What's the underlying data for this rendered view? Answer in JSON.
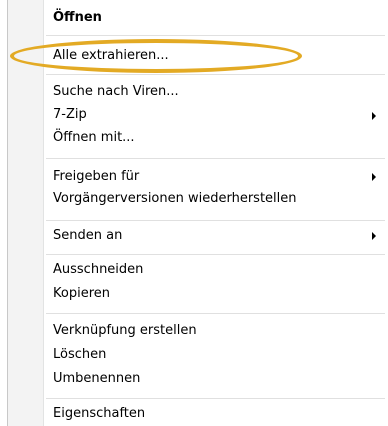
{
  "menu": {
    "items": [
      {
        "label": "Öffnen"
      },
      {
        "label": "Alle extrahieren..."
      },
      {
        "label": "Suche nach Viren..."
      },
      {
        "label": "7-Zip"
      },
      {
        "label": "Öffnen mit..."
      },
      {
        "label": "Freigeben für"
      },
      {
        "label": "Vorgängerversionen wiederherstellen"
      },
      {
        "label": "Senden an"
      },
      {
        "label": "Ausschneiden"
      },
      {
        "label": "Kopieren"
      },
      {
        "label": "Verknüpfung erstellen"
      },
      {
        "label": "Löschen"
      },
      {
        "label": "Umbenennen"
      },
      {
        "label": "Eigenschaften"
      }
    ]
  },
  "colors": {
    "highlight_ring": "#e3aa24",
    "gutter": "#f3f3f3",
    "separator": "#e0e0e0"
  },
  "icons": {
    "submenu": "submenu-arrow-icon"
  }
}
